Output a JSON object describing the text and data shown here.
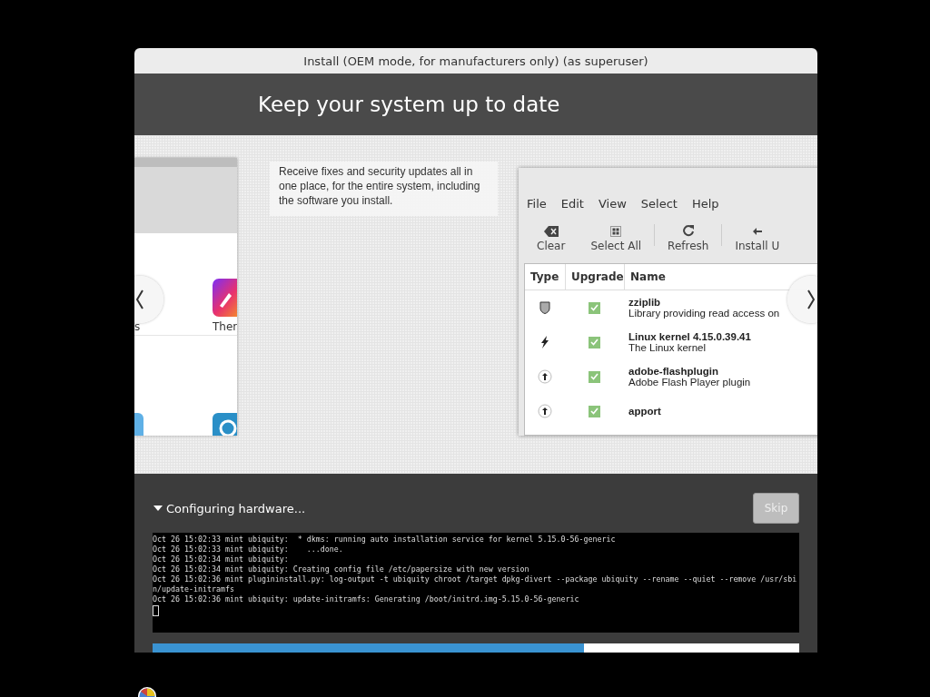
{
  "window": {
    "title": "Install (OEM mode, for manufacturers only) (as superuser)"
  },
  "header": {
    "title": "Keep your system up to date"
  },
  "slide": {
    "left_screenshot": {
      "labels": [
        "s",
        "Ther"
      ]
    },
    "caption": "Receive fixes and security updates all in one place, for the entire system, including the software you install.",
    "right_screenshot": {
      "menu": [
        "File",
        "Edit",
        "View",
        "Select",
        "Help"
      ],
      "toolbar": [
        {
          "kind": "clear",
          "label": "Clear"
        },
        {
          "kind": "select-all",
          "label": "Select All"
        },
        {
          "kind": "refresh",
          "label": "Refresh"
        },
        {
          "kind": "install",
          "label": "Install U"
        }
      ],
      "columns": [
        "Type",
        "Upgrade",
        "Name"
      ],
      "rows": [
        {
          "kind": "security",
          "checked": true,
          "name": "zziplib",
          "description": "Library providing read access on"
        },
        {
          "kind": "kernel",
          "checked": true,
          "name": "Linux kernel 4.15.0.39.41",
          "description": "The Linux kernel"
        },
        {
          "kind": "update",
          "checked": true,
          "name": "adobe-flashplugin",
          "description": "Adobe Flash Player plugin"
        },
        {
          "kind": "update",
          "checked": true,
          "name": "apport"
        }
      ]
    }
  },
  "progress": {
    "status": "Configuring hardware...",
    "expanded": true,
    "skip": {
      "label": "Skip",
      "disabled": true
    },
    "log": [
      "Oct 26 15:02:33 mint ubiquity:  * dkms: running auto installation service for kernel 5.15.0-56-generic",
      "Oct 26 15:02:33 mint ubiquity:    ...done.",
      "Oct 26 15:02:34 mint ubiquity:",
      "Oct 26 15:02:34 mint ubiquity: Creating config file /etc/papersize with new version",
      "Oct 26 15:02:36 mint plugininstall.py: log-output -t ubiquity chroot /target dpkg-divert --package ubiquity --rename --quiet --remove /usr/sbin/update-initramfs",
      "Oct 26 15:02:36 mint ubiquity: update-initramfs: Generating /boot/initrd.img-5.15.0-56-generic"
    ],
    "level": 0.667
  }
}
